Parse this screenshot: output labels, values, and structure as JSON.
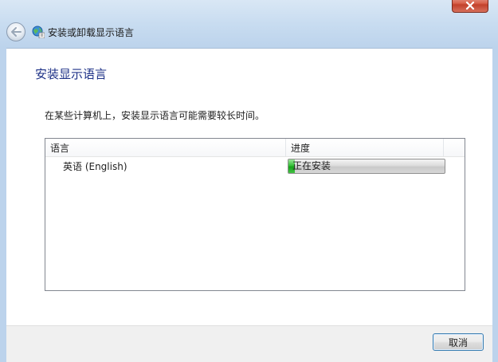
{
  "window": {
    "title": "安装或卸载显示语言"
  },
  "page": {
    "heading": "安装显示语言",
    "description": "在某些计算机上，安装显示语言可能需要较长时间。"
  },
  "listview": {
    "columns": [
      "语言",
      "进度"
    ],
    "rows": [
      {
        "language": "英语 (English)",
        "status": "正在安装",
        "progress_fraction": 0.04
      }
    ]
  },
  "footer": {
    "cancel_label": "取消"
  },
  "colors": {
    "heading": "#1e3287",
    "progress_green": "#16a41a",
    "close_button": "#c2412b"
  },
  "icons": {
    "close": "close-x-icon",
    "back": "back-arrow-icon",
    "nav": "globe-language-icon"
  }
}
